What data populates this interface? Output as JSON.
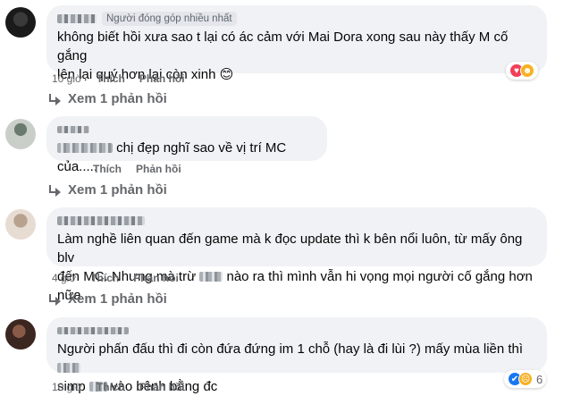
{
  "comments": [
    {
      "badge": "Người đóng góp nhiều nhất",
      "text_line1": "không biết hồi xưa sao t lại có ác cảm với Mai Dora xong sau này thấy M cố gắng",
      "text_line2": "lên lại quý hơn lại còn xinh 😊",
      "time": "10 giờ",
      "like": "Thích",
      "reply": "Phản hồi",
      "view_replies": "Xem 1 phản hồi"
    },
    {
      "text_line1": "chị đẹp nghĩ sao về vị trí MC của.....",
      "like": "Thích",
      "reply": "Phản hồi",
      "view_replies": "Xem 1 phản hồi"
    },
    {
      "text_line1": "Làm nghề liên quan đến game mà k đọc update thì k bên nổi luôn, từ mấy ông blv",
      "text_line2a": "đến MC. Nhưng mà trừ",
      "text_line2b": "nào ra thì mình vẫn hi vọng mọi người cố gắng hơn nữa",
      "time": "4 giờ",
      "like": "Thích",
      "reply": "Phản hồi",
      "view_replies": "Xem 1 phản hồi"
    },
    {
      "text_line1a": "Người phấn đấu thì đi còn đứa đứng im 1 chỗ (hay là đi lùi ?) mấy mùa liền thì",
      "text_line2a": "simp",
      "text_line2b": "vào bênh bằng đc",
      "time": "10 giờ",
      "like": "Thích",
      "reply": "Phản hồi",
      "reaction_count": "6"
    }
  ],
  "icons": {
    "love": "love-reaction-icon",
    "care": "care-reaction-icon",
    "like": "like-reaction-icon",
    "sad": "sad-reaction-icon",
    "reply_arrow": "reply-arrow-icon"
  },
  "colors": {
    "bubble": "#f0f2f5",
    "meta": "#65676b",
    "love": "#f33e58",
    "like": "#1877f2",
    "care": "#f7b125"
  }
}
